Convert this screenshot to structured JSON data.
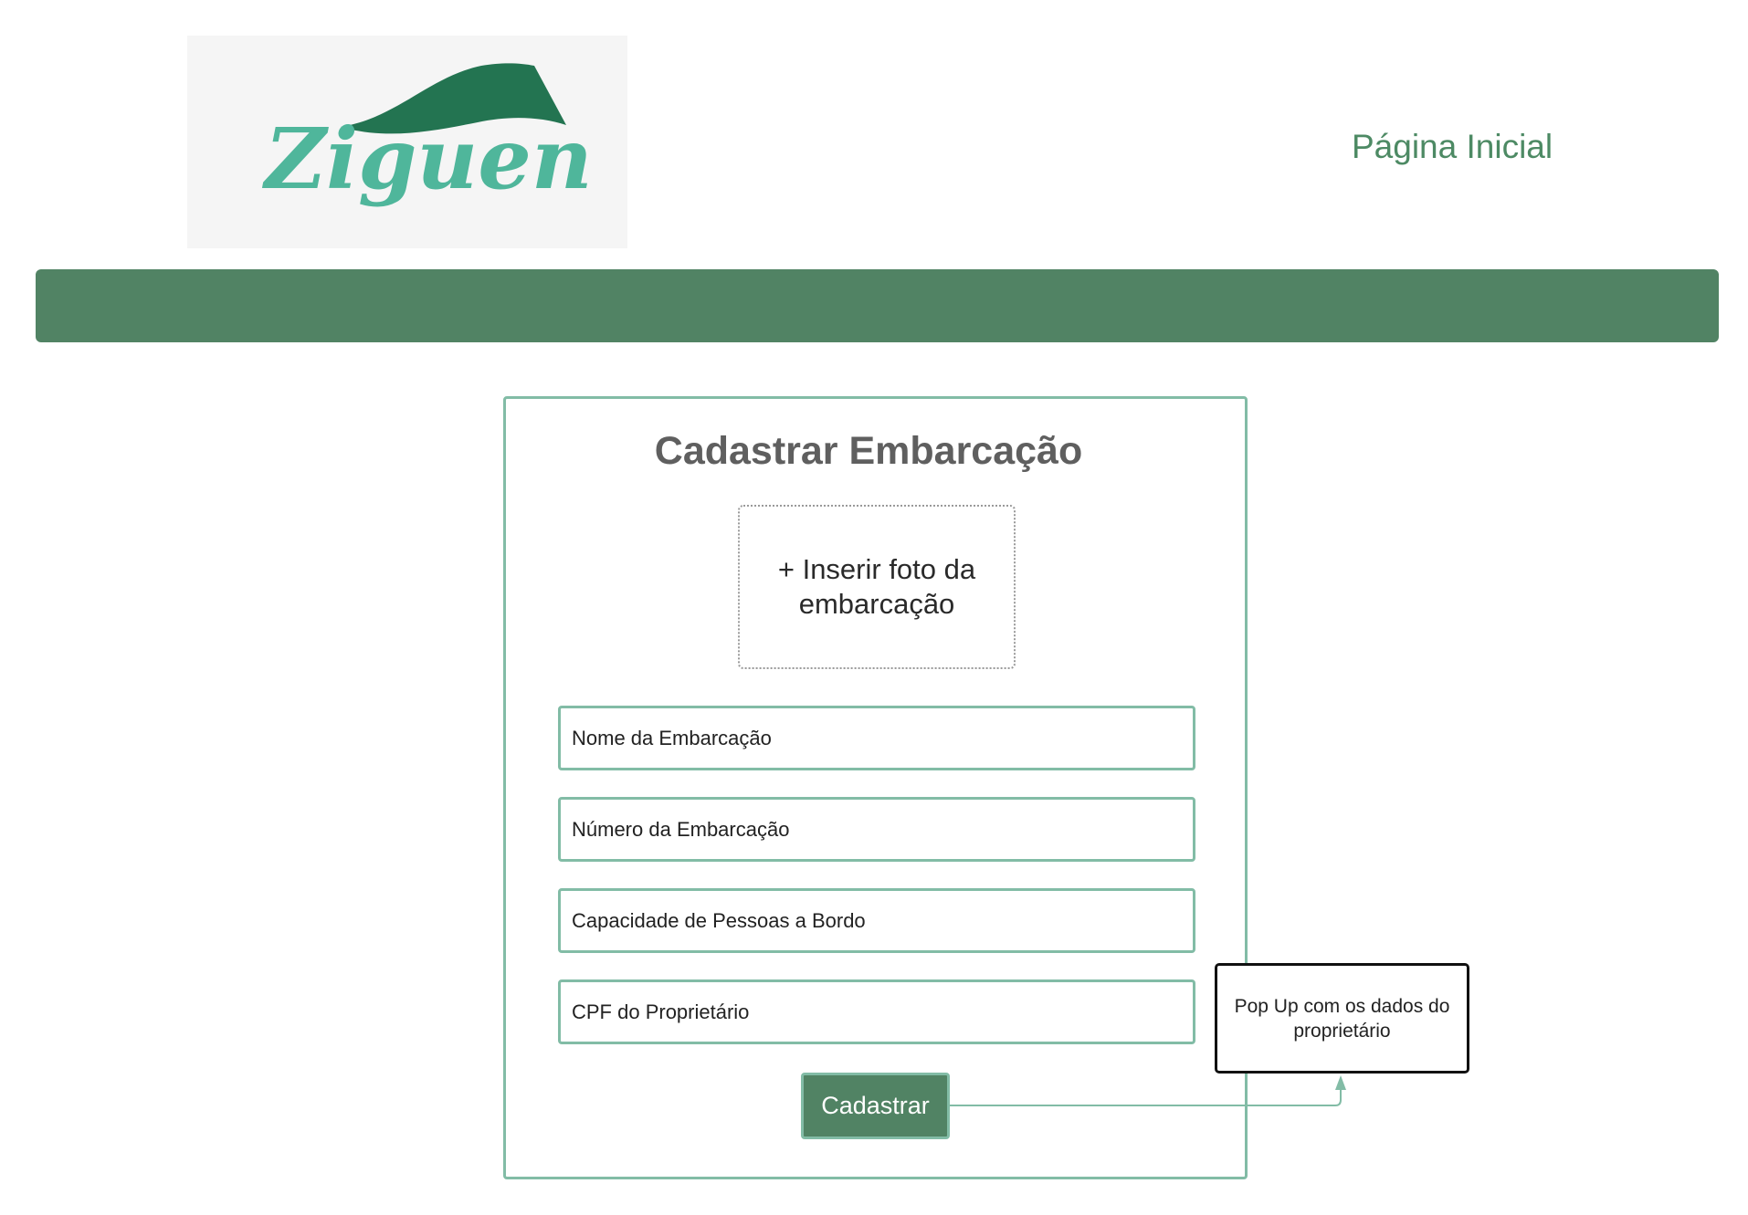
{
  "logo": {
    "text": "Ziguen",
    "colors": {
      "text": "#4fb69b",
      "wave": "#237451"
    }
  },
  "nav": {
    "home_label": "Página Inicial"
  },
  "colors": {
    "accent": "#518364",
    "border": "#82bca6",
    "title": "#5f5f5f"
  },
  "form": {
    "title": "Cadastrar Embarcação",
    "photo_upload_label": "+ Inserir foto da embarcação",
    "fields": [
      {
        "placeholder": "Nome da Embarcação"
      },
      {
        "placeholder": "Número da Embarcação"
      },
      {
        "placeholder": "Capacidade de Pessoas a Bordo"
      },
      {
        "placeholder": "CPF do Proprietário"
      }
    ],
    "submit_label": "Cadastrar"
  },
  "annotation": {
    "popup_text": "Pop Up com os dados do proprietário"
  }
}
